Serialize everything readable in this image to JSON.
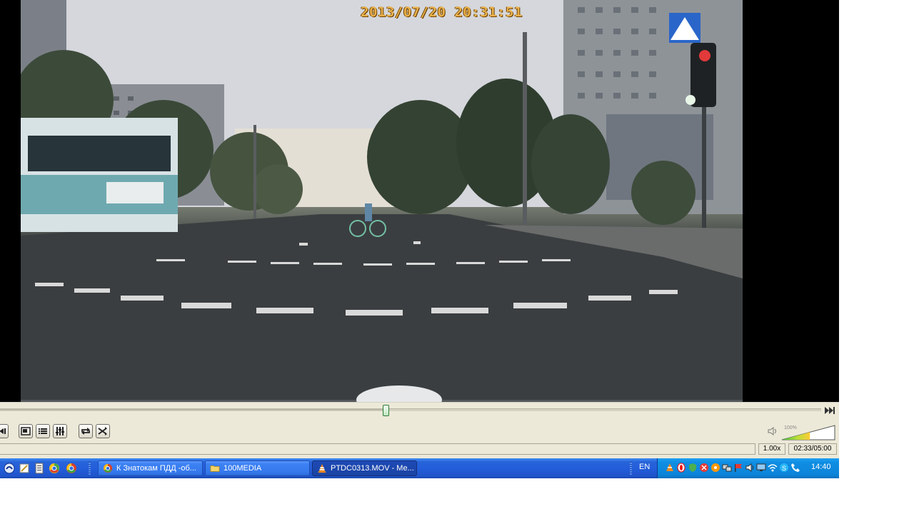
{
  "video": {
    "osd_timestamp": "2013/07/20  20:31:51",
    "playback_progress": 0.466
  },
  "player": {
    "volume_percent_label": "100%",
    "volume_level": 1.0,
    "speed": "1.00x",
    "time": "02:33/05:00",
    "buttons": {
      "prev": "previous-chapter-icon",
      "fullscreen": "fullscreen-icon",
      "playlist": "playlist-icon",
      "extended": "equalizer-icon",
      "loop": "loop-icon",
      "random": "shuffle-icon",
      "next_frame": "next-frame-icon"
    }
  },
  "taskbar": {
    "quick_launch": [
      "show-desktop-icon",
      "notepad-icon",
      "document-icon",
      "chrome-icon",
      "chrome-icon"
    ],
    "tasks": [
      {
        "label": "К Знатокам ПДД -об...",
        "icon": "chrome-icon",
        "active": false
      },
      {
        "label": "100MEDIA",
        "icon": "folder-icon",
        "active": false
      },
      {
        "label": "PTDC0313.MOV - Me...",
        "icon": "vlc-cone-icon",
        "active": true
      }
    ],
    "language": "EN",
    "clock": "14:40",
    "tray_icons": [
      "vlc-icon",
      "opera-icon",
      "shield-icon",
      "antivirus-icon",
      "media-icon",
      "network-icon",
      "flag-icon",
      "volume-icon",
      "display-icon",
      "wifi-icon",
      "skype-icon",
      "phone-icon"
    ],
    "colors": {
      "taskbar": "#245edb",
      "tray": "#0c84d9"
    }
  }
}
